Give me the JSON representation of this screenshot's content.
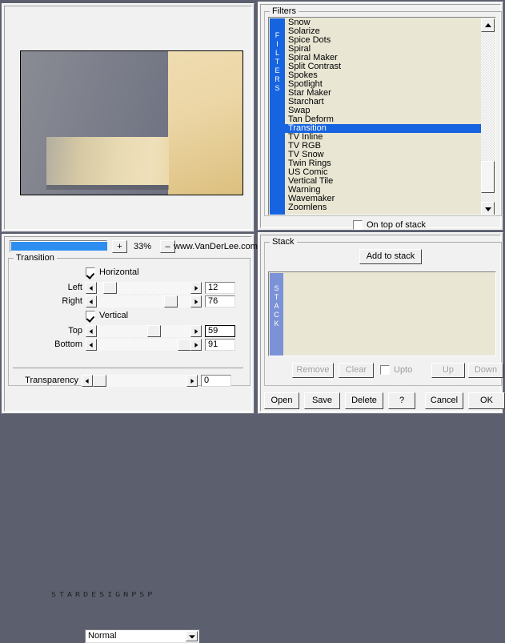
{
  "preview": {
    "name": "filter-preview",
    "colors": {
      "gray": "#787b88",
      "tan": "#e8d7a8",
      "band": "#e3d4ab"
    }
  },
  "zoombar": {
    "progress_percent": 100,
    "plus_label": "+",
    "minus_label": "–",
    "zoom_value": "33%",
    "website": "www.VanDerLee.com",
    "accent_color": "#2e8ef0"
  },
  "transition_group": {
    "title": "Transition",
    "horizontal": {
      "label": "Horizontal",
      "checked": true
    },
    "vertical": {
      "label": "Vertical",
      "checked": true
    },
    "sliders": [
      {
        "label": "Left",
        "value": "12",
        "thumb_pct": 6,
        "focused": false
      },
      {
        "label": "Right",
        "value": "76",
        "thumb_pct": 73,
        "focused": false
      },
      {
        "label": "Top",
        "value": "59",
        "thumb_pct": 55,
        "focused": true
      },
      {
        "label": "Bottom",
        "value": "91",
        "thumb_pct": 88,
        "focused": false
      }
    ],
    "brand": "STARDESIGNPSP",
    "transparency": {
      "label": "Transparency",
      "value": "0",
      "thumb_pct": 2
    },
    "blend_mode": "Normal"
  },
  "filters_group": {
    "title": "Filters",
    "vertical_label": "FILTERS",
    "selected": "Transition",
    "items": [
      "Snow",
      "Solarize",
      "Spice Dots",
      "Spiral",
      "Spiral Maker",
      "Split Contrast",
      "Spokes",
      "Spotlight",
      "Star Maker",
      "Starchart",
      "Swap",
      "Tan Deform",
      "Transition",
      "TV Inline",
      "TV RGB",
      "TV Snow",
      "Twin Rings",
      "US Comic",
      "Vertical Tile",
      "Warning",
      "Wavemaker",
      "Zoomlens"
    ],
    "on_top_of_stack": {
      "label": "On top of stack",
      "checked": false
    }
  },
  "stack_group": {
    "title": "Stack",
    "vertical_label": "STACK",
    "add_label": "Add to stack",
    "items": [],
    "buttons": [
      {
        "label": "Remove",
        "disabled": true
      },
      {
        "label": "Clear",
        "disabled": true
      },
      {
        "label": "Up",
        "disabled": true
      },
      {
        "label": "Down",
        "disabled": true
      }
    ],
    "upto": {
      "label": "Upto",
      "checked": false,
      "disabled": true
    }
  },
  "bottom_buttons": [
    {
      "label": "Open"
    },
    {
      "label": "Save"
    },
    {
      "label": "Delete"
    },
    {
      "label": "?"
    },
    {
      "label": "Cancel"
    },
    {
      "label": "OK"
    }
  ]
}
